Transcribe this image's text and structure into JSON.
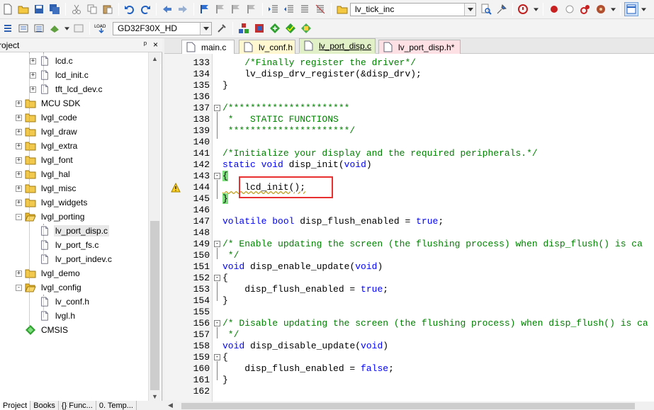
{
  "toolbar1": {
    "target_combo": "lv_tick_inc",
    "icons": [
      "new-file-icon",
      "open-folder-icon",
      "save-icon",
      "save-all-icon",
      "cut-icon",
      "copy-icon",
      "paste-icon",
      "undo-icon",
      "redo-icon",
      "back-icon",
      "forward-icon",
      "bookmark-icon",
      "bookmark-prev-icon",
      "bookmark-next-icon",
      "bookmark-clear-icon",
      "indent-icon",
      "unindent-icon",
      "comment-icon",
      "uncomment-icon",
      "find-in-files-icon",
      "find-icon",
      "incremental-find-icon",
      "debug-icon",
      "breakpoint-icon",
      "breakpoint-disable-icon",
      "kill-breakpoints-icon",
      "window-icon"
    ]
  },
  "toolbar2": {
    "target_combo": "GD32F30X_HD",
    "load_label": "LOAD"
  },
  "panel": {
    "title": "roject",
    "pin": "ᵖ",
    "close": "×"
  },
  "tree": [
    {
      "label": "lcd.c",
      "kind": "file",
      "expander": "+"
    },
    {
      "label": "lcd_init.c",
      "kind": "file",
      "expander": "+"
    },
    {
      "label": "tft_lcd_dev.c",
      "kind": "file",
      "expander": "+"
    },
    {
      "label": "MCU SDK",
      "kind": "folder",
      "expander": "+"
    },
    {
      "label": "lvgl_code",
      "kind": "folder",
      "expander": "+"
    },
    {
      "label": "lvgl_draw",
      "kind": "folder",
      "expander": "+"
    },
    {
      "label": "lvgl_extra",
      "kind": "folder",
      "expander": "+"
    },
    {
      "label": "lvgl_font",
      "kind": "folder",
      "expander": "+"
    },
    {
      "label": "lvgl_hal",
      "kind": "folder",
      "expander": "+"
    },
    {
      "label": "lvgl_misc",
      "kind": "folder",
      "expander": "+"
    },
    {
      "label": "lvgl_widgets",
      "kind": "folder",
      "expander": "+"
    },
    {
      "label": "lvgl_porting",
      "kind": "folder-open",
      "expander": "-"
    },
    {
      "label": "lv_port_disp.c",
      "kind": "file",
      "expander": "",
      "selected": true
    },
    {
      "label": "lv_port_fs.c",
      "kind": "file",
      "expander": ""
    },
    {
      "label": "lv_port_indev.c",
      "kind": "file",
      "expander": ""
    },
    {
      "label": "lvgl_demo",
      "kind": "folder",
      "expander": "+"
    },
    {
      "label": "lvgl_config",
      "kind": "folder-open",
      "expander": "-"
    },
    {
      "label": "lv_conf.h",
      "kind": "file",
      "expander": ""
    },
    {
      "label": "lvgl.h",
      "kind": "file",
      "expander": ""
    },
    {
      "label": "CMSIS",
      "kind": "component",
      "expander": ""
    }
  ],
  "bottom_tabs": [
    {
      "label": "Project",
      "active": true
    },
    {
      "label": "Books",
      "active": false
    },
    {
      "label": "{} Func...",
      "active": false
    },
    {
      "label": "0. Temp...",
      "active": false
    }
  ],
  "editor_tabs": [
    {
      "label": "main.c",
      "bg": "#ffffff"
    },
    {
      "label": "lv_conf.h",
      "bg": "#fff7cf"
    },
    {
      "label": "lv_port_disp.c",
      "bg": "#e2f0c8",
      "active": true
    },
    {
      "label": "lv_port_disp.h*",
      "bg": "#fde0e4"
    }
  ],
  "code": [
    {
      "n": "133",
      "segs": [
        [
          "c",
          "    /*Finally register the driver*/"
        ]
      ]
    },
    {
      "n": "134",
      "segs": [
        [
          "t",
          "    lv_disp_drv_register(&disp_drv);"
        ]
      ]
    },
    {
      "n": "135",
      "segs": [
        [
          "t",
          "}"
        ]
      ]
    },
    {
      "n": "136",
      "segs": []
    },
    {
      "n": "137",
      "fold": "-",
      "segs": [
        [
          "c",
          "/**********************"
        ]
      ]
    },
    {
      "n": "138",
      "segs": [
        [
          "c",
          " *   STATIC FUNCTIONS"
        ]
      ]
    },
    {
      "n": "139",
      "segs": [
        [
          "c",
          " **********************/"
        ]
      ]
    },
    {
      "n": "140",
      "segs": []
    },
    {
      "n": "141",
      "segs": [
        [
          "c",
          "/*Initialize your display and the required peripherals.*/"
        ]
      ]
    },
    {
      "n": "142",
      "segs": [
        [
          "k",
          "static"
        ],
        [
          "t",
          " "
        ],
        [
          "k",
          "void"
        ],
        [
          "t",
          " disp_init("
        ],
        [
          "k",
          "void"
        ],
        [
          "t",
          ")"
        ]
      ]
    },
    {
      "n": "143",
      "fold": "-",
      "segs": [
        [
          "b",
          "{"
        ]
      ]
    },
    {
      "n": "144",
      "segs": [
        [
          "t",
          "    lcd_init();"
        ]
      ]
    },
    {
      "n": "145",
      "segs": [
        [
          "b",
          "}"
        ]
      ]
    },
    {
      "n": "146",
      "segs": []
    },
    {
      "n": "147",
      "segs": [
        [
          "k",
          "volatile"
        ],
        [
          "t",
          " "
        ],
        [
          "k",
          "bool"
        ],
        [
          "t",
          " disp_flush_enabled = "
        ],
        [
          "k",
          "true"
        ],
        [
          "t",
          ";"
        ]
      ]
    },
    {
      "n": "148",
      "segs": []
    },
    {
      "n": "149",
      "fold": "-",
      "segs": [
        [
          "c",
          "/* Enable updating the screen (the flushing process) when disp_flush() is ca"
        ]
      ]
    },
    {
      "n": "150",
      "segs": [
        [
          "c",
          " */"
        ]
      ]
    },
    {
      "n": "151",
      "segs": [
        [
          "k",
          "void"
        ],
        [
          "t",
          " disp_enable_update("
        ],
        [
          "k",
          "void"
        ],
        [
          "t",
          ")"
        ]
      ]
    },
    {
      "n": "152",
      "fold": "-",
      "segs": [
        [
          "t",
          "{"
        ]
      ]
    },
    {
      "n": "153",
      "segs": [
        [
          "t",
          "    disp_flush_enabled = "
        ],
        [
          "k",
          "true"
        ],
        [
          "t",
          ";"
        ]
      ]
    },
    {
      "n": "154",
      "segs": [
        [
          "t",
          "}"
        ]
      ]
    },
    {
      "n": "155",
      "segs": []
    },
    {
      "n": "156",
      "fold": "-",
      "segs": [
        [
          "c",
          "/* Disable updating the screen (the flushing process) when disp_flush() is ca"
        ]
      ]
    },
    {
      "n": "157",
      "segs": [
        [
          "c",
          " */"
        ]
      ]
    },
    {
      "n": "158",
      "segs": [
        [
          "k",
          "void"
        ],
        [
          "t",
          " disp_disable_update("
        ],
        [
          "k",
          "void"
        ],
        [
          "t",
          ")"
        ]
      ]
    },
    {
      "n": "159",
      "fold": "-",
      "segs": [
        [
          "t",
          "{"
        ]
      ]
    },
    {
      "n": "160",
      "segs": [
        [
          "t",
          "    disp_flush_enabled = "
        ],
        [
          "k",
          "false"
        ],
        [
          "t",
          ";"
        ]
      ]
    },
    {
      "n": "161",
      "segs": [
        [
          "t",
          "}"
        ]
      ]
    },
    {
      "n": "162",
      "segs": []
    }
  ],
  "colors": {
    "comment": "#008000",
    "keyword": "#0000ff",
    "highlight_box": "#e83030",
    "brace_highlight": "#7fe07f"
  }
}
